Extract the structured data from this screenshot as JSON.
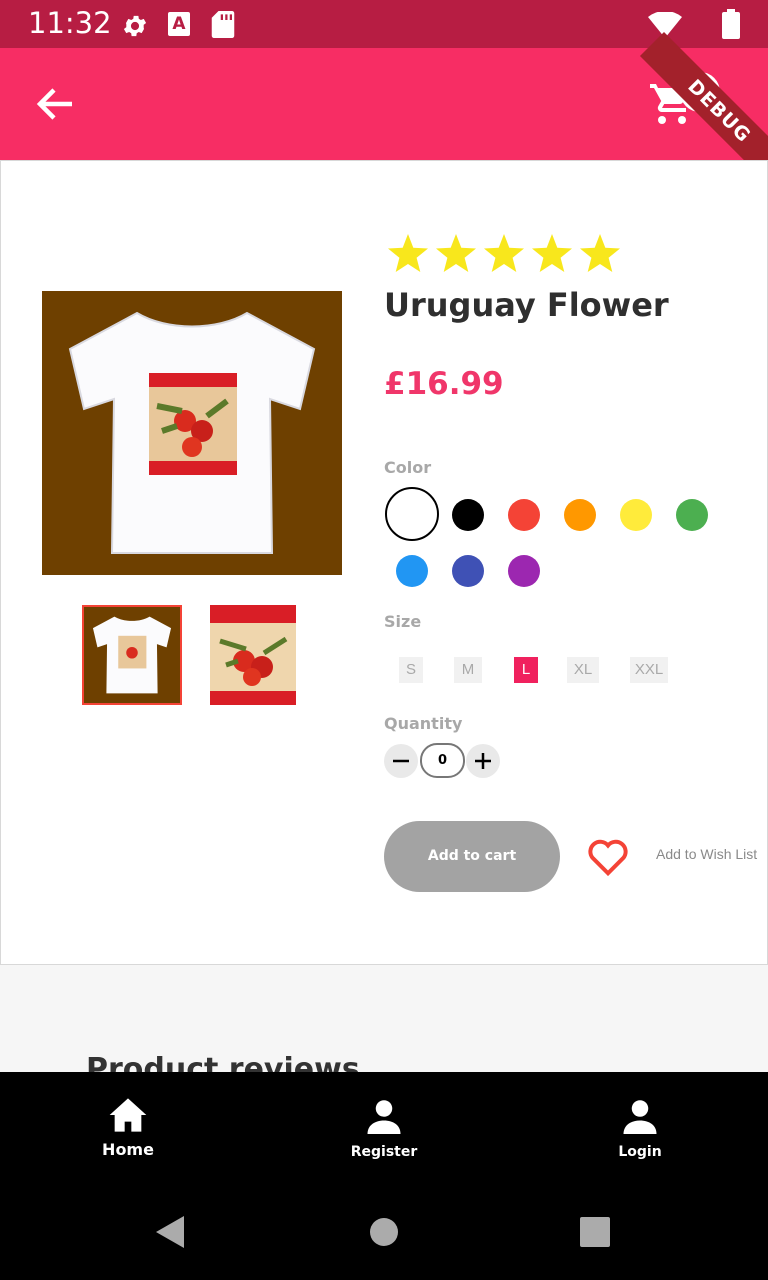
{
  "status": {
    "time": "11:32"
  },
  "header": {
    "cart_count": "12",
    "debug_label": "DEBUG"
  },
  "product": {
    "name": "Uruguay Flower",
    "price": "£16.99",
    "rating": 5,
    "color_label": "Color",
    "colors": [
      "#ffffff",
      "#000000",
      "#f44336",
      "#ff9800",
      "#ffeb3b",
      "#4caf50",
      "#2196f3",
      "#3f51b5",
      "#9c27b0"
    ],
    "size_label": "Size",
    "sizes": [
      "S",
      "M",
      "L",
      "XL",
      "XXL"
    ],
    "selected_size": "L",
    "quantity_label": "Quantity",
    "quantity": "0",
    "add_to_cart": "Add to cart",
    "wishlist": "Add to Wish List"
  },
  "reviews_heading": "Product reviews",
  "bottom_nav": {
    "items": [
      {
        "label": "Home"
      },
      {
        "label": "Register"
      },
      {
        "label": "Login"
      }
    ]
  },
  "colors": {
    "brand": "#f72d64",
    "status_bar": "#b71d43",
    "star": "#f8e71c"
  }
}
